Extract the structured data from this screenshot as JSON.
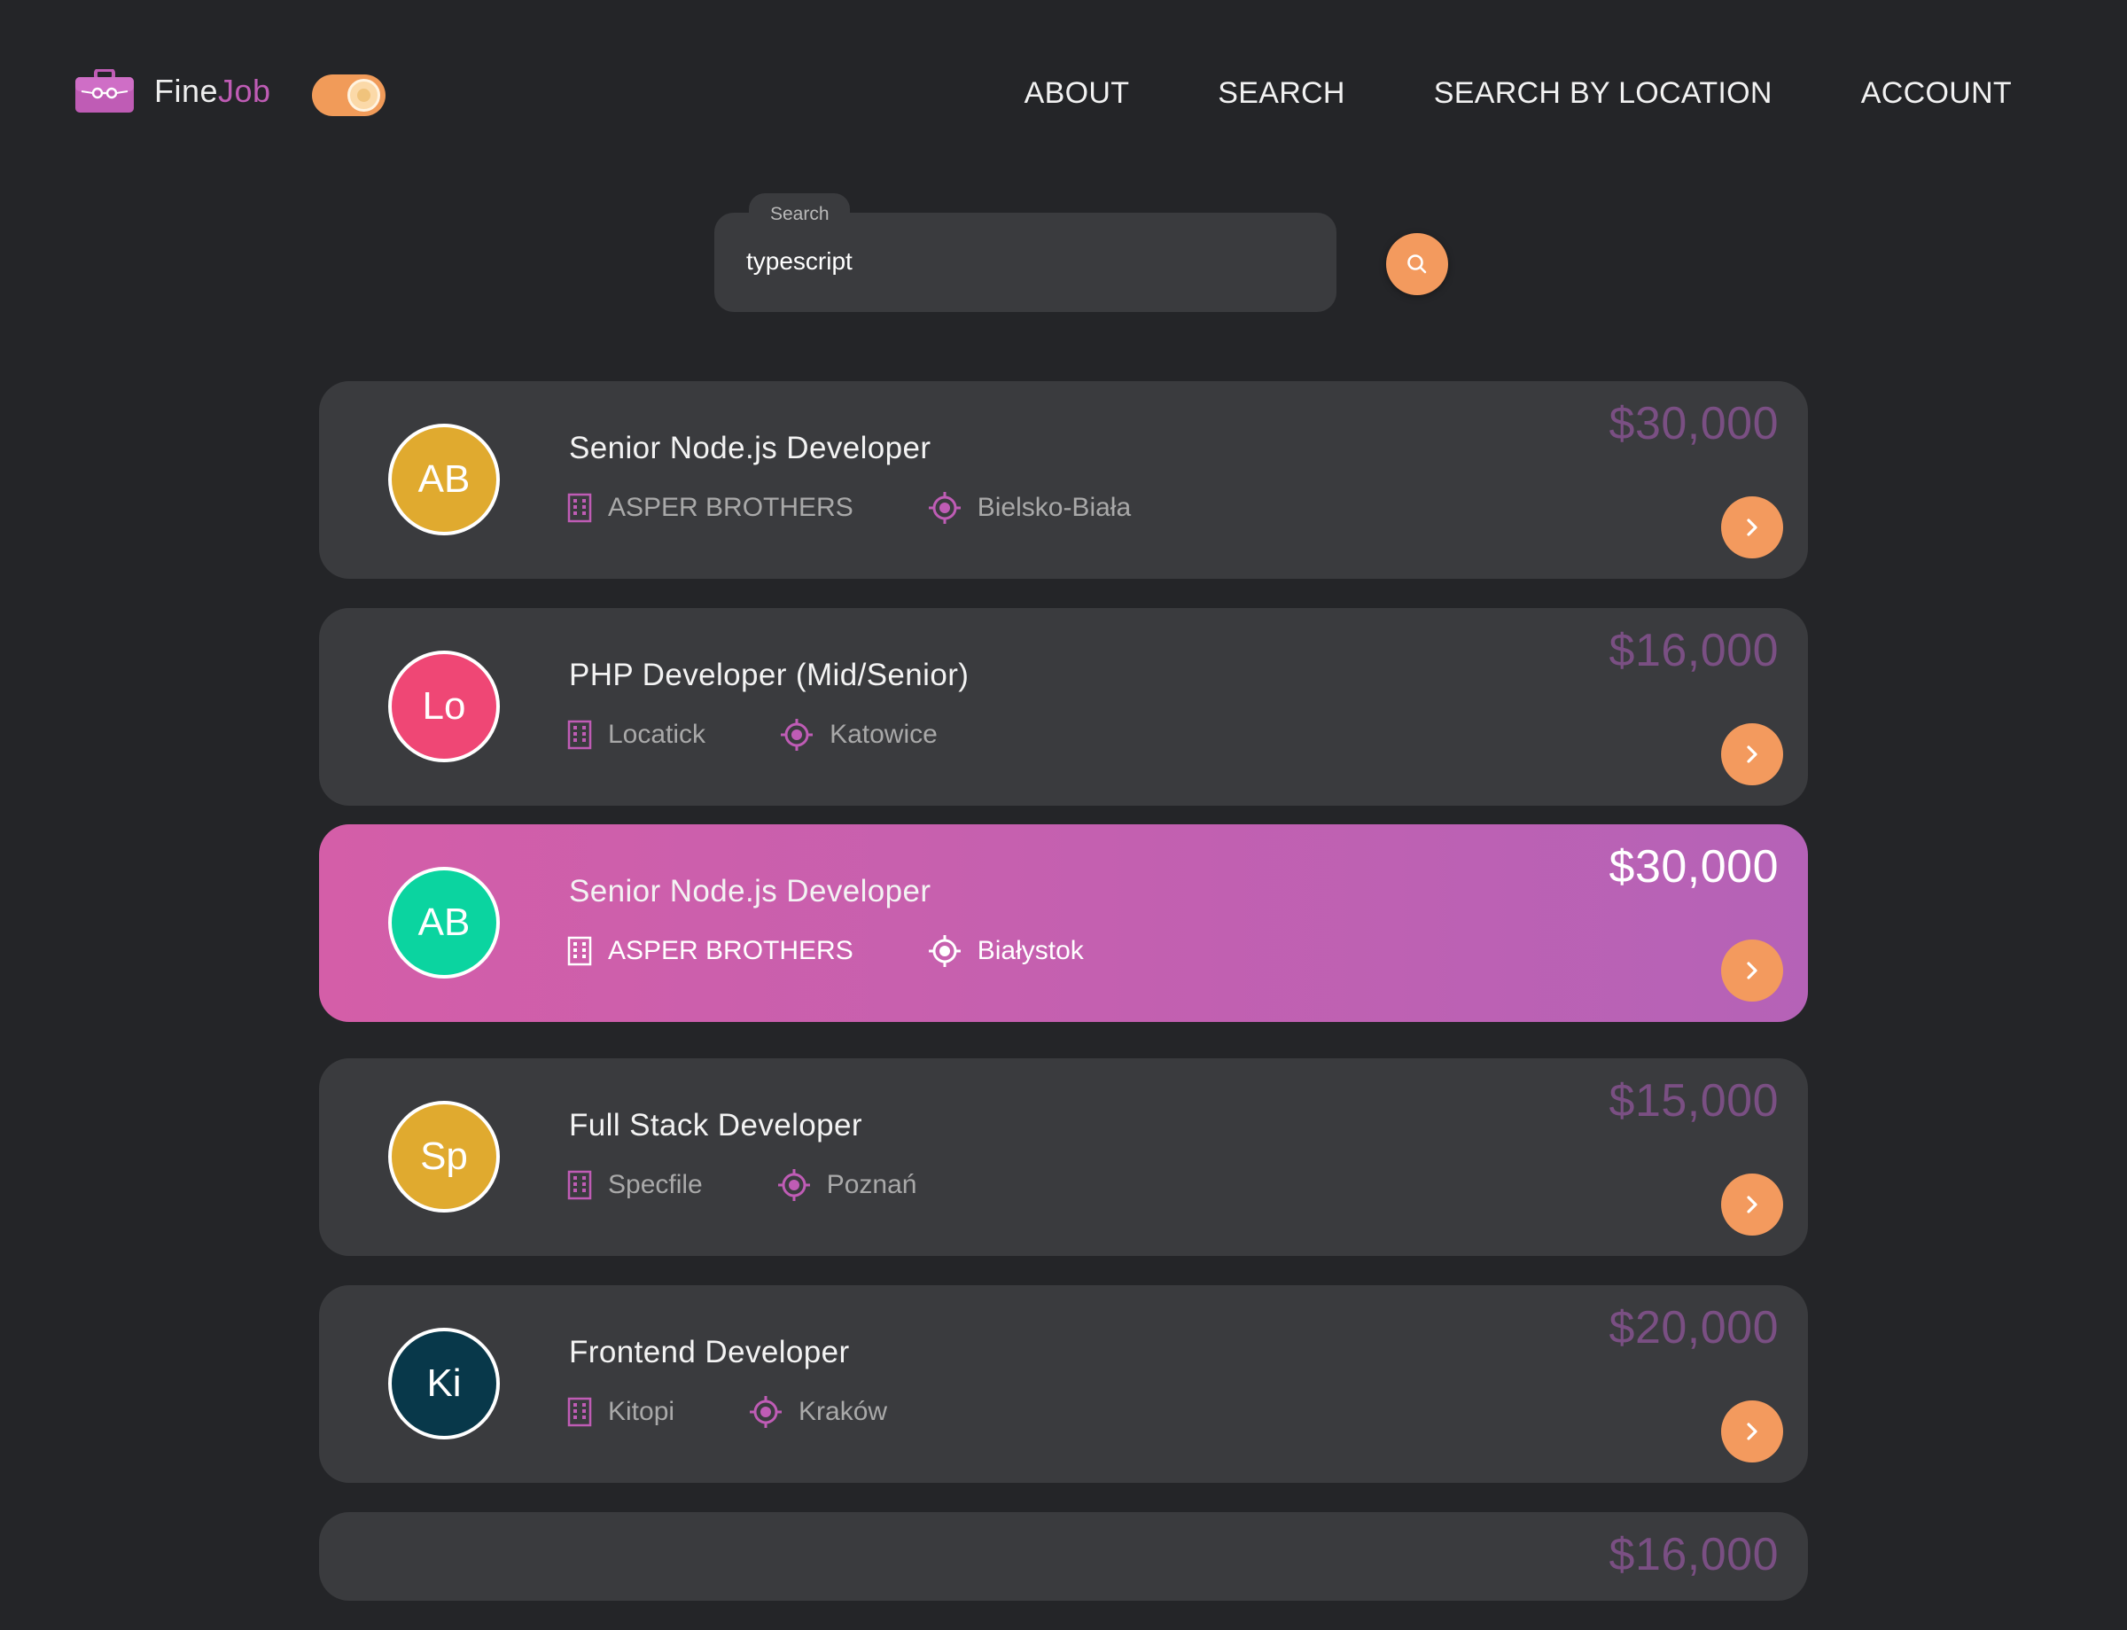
{
  "header": {
    "logo_main": "Fine",
    "logo_accent": "Job",
    "nav": [
      "ABOUT",
      "SEARCH",
      "SEARCH BY LOCATION",
      "ACCOUNT"
    ]
  },
  "search": {
    "label": "Search",
    "value": "typescript"
  },
  "colors": {
    "background": "#242528",
    "card": "#3a3b3e",
    "accent_purple": "#bf5cb5",
    "accent_orange": "#f39a5e",
    "salary_muted": "#7a4f83"
  },
  "jobs": [
    {
      "initials": "AB",
      "avatar_color": "#e0aa2f",
      "title": "Senior Node.js Developer",
      "company": "ASPER BROTHERS",
      "location": "Bielsko-Biała",
      "salary": "$30,000"
    },
    {
      "initials": "Lo",
      "avatar_color": "#ef4775",
      "title": "PHP Developer (Mid/Senior)",
      "company": "Locatick",
      "location": "Katowice",
      "salary": "$16,000"
    },
    {
      "initials": "AB",
      "avatar_color": "#0bd4a0",
      "title": "Senior Node.js Developer",
      "company": "ASPER BROTHERS",
      "location": "Białystok",
      "salary": "$30,000",
      "highlighted": true
    },
    {
      "initials": "Sp",
      "avatar_color": "#e0aa2f",
      "title": "Full Stack Developer",
      "company": "Specfile",
      "location": "Poznań",
      "salary": "$15,000"
    },
    {
      "initials": "Ki",
      "avatar_color": "#08384a",
      "title": "Frontend Developer",
      "company": "Kitopi",
      "location": "Kraków",
      "salary": "$20,000"
    },
    {
      "salary": "$16,000",
      "partial": true
    }
  ]
}
